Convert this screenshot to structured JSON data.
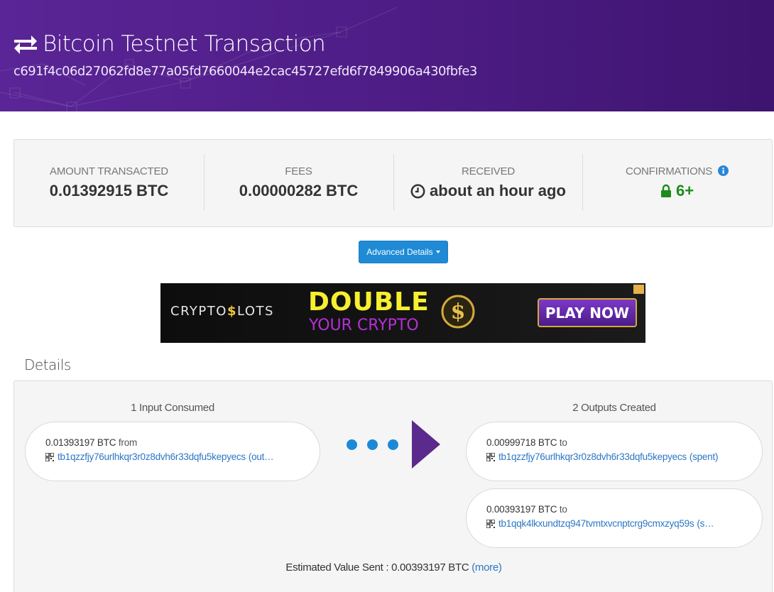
{
  "header": {
    "title": "Bitcoin Testnet Transaction",
    "tx_hash": "c691f4c06d27062fd8e77a05fd7660044e2cac45727efd6f7849906a430fbfe3",
    "icon": "exchange-arrows-icon"
  },
  "summary": {
    "amount": {
      "label": "AMOUNT TRANSACTED",
      "value": "0.01392915 BTC"
    },
    "fees": {
      "label": "FEES",
      "value": "0.00000282 BTC"
    },
    "received": {
      "label": "RECEIVED",
      "value": "about an hour ago",
      "icon": "clock-icon"
    },
    "confirmations": {
      "label": "CONFIRMATIONS",
      "value": "6+",
      "icon": "lock-icon",
      "info_icon": "info-icon"
    }
  },
  "advanced_button": {
    "label": "Advanced Details"
  },
  "ad": {
    "logo_prefix": "CRYPTO",
    "logo_s": "$",
    "logo_suffix": "LOTS",
    "headline": "DOUBLE",
    "subline": "YOUR CRYPTO",
    "cta": "PLAY NOW"
  },
  "details": {
    "title": "Details",
    "inputs_header": "1 Input Consumed",
    "outputs_header": "2 Outputs Created",
    "inputs": [
      {
        "amount": "0.01393197 BTC",
        "suffix": "from",
        "address": "tb1qzzfjy76urlhkqr3r0z8dvh6r33dqfu5kepyecs",
        "tag": "(out…"
      }
    ],
    "outputs": [
      {
        "amount": "0.00999718 BTC",
        "suffix": "to",
        "address": "tb1qzzfjy76urlhkqr3r0z8dvh6r33dqfu5kepyecs",
        "tag": "(spent)"
      },
      {
        "amount": "0.00393197 BTC",
        "suffix": "to",
        "address": "tb1qqk4lkxundtzq947tvmtxvcnptcrg9cmxzyq59s",
        "tag": "(s…"
      }
    ],
    "estimated": {
      "label": "Estimated Value Sent",
      "sep": " : ",
      "value": "0.00393197 BTC",
      "more": "(more)"
    }
  },
  "colors": {
    "header_purple": "#4e1d86",
    "accent_blue": "#1f8bd6",
    "link_blue": "#2c76c4",
    "confirm_green": "#1c8a1c",
    "arrow_purple": "#5a2a8c"
  }
}
